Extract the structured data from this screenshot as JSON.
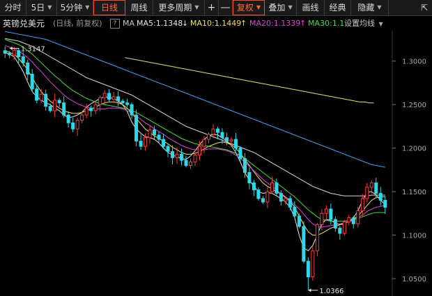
{
  "toolbar": {
    "items": [
      {
        "label": "分时"
      },
      {
        "label": "5日",
        "dropdown": true
      },
      {
        "label": "5分钟",
        "dropdown": true
      },
      {
        "label": "日线",
        "active": true
      },
      {
        "label": "周线"
      },
      {
        "label": "更多周期",
        "dropdown": true
      },
      {
        "label": "+"
      },
      {
        "label": "—"
      },
      {
        "label": "复权",
        "dropdown": true,
        "active": true
      },
      {
        "label": "叠加",
        "dropdown": true
      },
      {
        "label": "画线"
      },
      {
        "label": "经典"
      },
      {
        "label": "隐藏",
        "dropdown": true
      }
    ]
  },
  "legend": {
    "instrument": "英镑兑美元",
    "mode": "(日线, 前复权)",
    "help": "?",
    "ma_label": "MA",
    "ma5": "MA5:1.1348",
    "ma5_arrow": "↓",
    "ma10": "MA10:1.1449",
    "ma10_arrow": "↑",
    "ma20": "MA20:1.1339",
    "ma20_arrow": "↑",
    "ma30": "MA30:1.1",
    "settings": "设置均线",
    "colors": {
      "ma5": "#e8e8e8",
      "ma10": "#f0e25a",
      "ma20": "#e040e0",
      "ma30": "#40e040"
    }
  },
  "chart_data": {
    "type": "candlestick",
    "instrument": "英镑兑美元",
    "ylim": [
      1.03,
      1.335
    ],
    "y_ticks": [
      "1.3000",
      "1.2500",
      "1.2000",
      "1.1500",
      "1.1000",
      "1.0500"
    ],
    "annotations": [
      {
        "label": "1.3147",
        "value": 1.3147,
        "kind": "high"
      },
      {
        "label": "1.0366",
        "value": 1.0366,
        "kind": "low"
      }
    ],
    "close_series": [
      1.309,
      1.307,
      1.312,
      1.305,
      1.298,
      1.285,
      1.268,
      1.255,
      1.262,
      1.248,
      1.243,
      1.255,
      1.252,
      1.238,
      1.229,
      1.222,
      1.232,
      1.238,
      1.246,
      1.243,
      1.25,
      1.258,
      1.263,
      1.256,
      1.259,
      1.254,
      1.252,
      1.25,
      1.238,
      1.208,
      1.202,
      1.212,
      1.221,
      1.215,
      1.21,
      1.202,
      1.196,
      1.189,
      1.193,
      1.186,
      1.18,
      1.184,
      1.192,
      1.202,
      1.21,
      1.216,
      1.222,
      1.218,
      1.212,
      1.208,
      1.21,
      1.2,
      1.188,
      1.172,
      1.16,
      1.152,
      1.142,
      1.138,
      1.15,
      1.16,
      1.148,
      1.139,
      1.142,
      1.132,
      1.122,
      1.11,
      1.07,
      1.052,
      1.082,
      1.112,
      1.125,
      1.13,
      1.118,
      1.108,
      1.102,
      1.115,
      1.12,
      1.113,
      1.128,
      1.142,
      1.155,
      1.16,
      1.148,
      1.14,
      1.132
    ],
    "ma_series": [
      {
        "name": "MA5",
        "color": "#e8e8e8",
        "values": [
          1.31,
          1.308,
          1.305,
          1.297,
          1.288,
          1.276,
          1.265,
          1.259,
          1.255,
          1.252,
          1.25,
          1.246,
          1.243,
          1.238,
          1.235,
          1.236,
          1.238,
          1.241,
          1.247,
          1.251,
          1.254,
          1.257,
          1.259,
          1.258,
          1.257,
          1.254,
          1.25,
          1.242,
          1.23,
          1.222,
          1.217,
          1.213,
          1.212,
          1.21,
          1.206,
          1.2,
          1.195,
          1.192,
          1.19,
          1.188,
          1.187,
          1.191,
          1.197,
          1.204,
          1.21,
          1.214,
          1.216,
          1.215,
          1.212,
          1.208,
          1.203,
          1.195,
          1.184,
          1.172,
          1.163,
          1.156,
          1.15,
          1.148,
          1.149,
          1.148,
          1.145,
          1.142,
          1.138,
          1.132,
          1.12,
          1.1,
          1.085,
          1.082,
          1.088,
          1.1,
          1.113,
          1.118,
          1.117,
          1.114,
          1.112,
          1.113,
          1.116,
          1.12,
          1.128,
          1.14,
          1.149,
          1.15,
          1.146,
          1.14,
          1.135
        ]
      },
      {
        "name": "MA10",
        "color": "#f0e25a",
        "values": [
          1.312,
          1.31,
          1.308,
          1.303,
          1.297,
          1.29,
          1.281,
          1.272,
          1.265,
          1.259,
          1.254,
          1.25,
          1.246,
          1.243,
          1.241,
          1.24,
          1.24,
          1.241,
          1.243,
          1.245,
          1.247,
          1.25,
          1.252,
          1.253,
          1.253,
          1.252,
          1.25,
          1.246,
          1.24,
          1.234,
          1.228,
          1.222,
          1.218,
          1.214,
          1.211,
          1.208,
          1.205,
          1.201,
          1.198,
          1.195,
          1.193,
          1.193,
          1.194,
          1.196,
          1.199,
          1.202,
          1.204,
          1.206,
          1.207,
          1.206,
          1.204,
          1.2,
          1.194,
          1.187,
          1.18,
          1.173,
          1.166,
          1.16,
          1.156,
          1.153,
          1.15,
          1.147,
          1.143,
          1.139,
          1.132,
          1.122,
          1.112,
          1.104,
          1.1,
          1.1,
          1.102,
          1.105,
          1.108,
          1.11,
          1.112,
          1.114,
          1.116,
          1.118,
          1.122,
          1.128,
          1.134,
          1.14,
          1.143,
          1.144,
          1.144
        ]
      },
      {
        "name": "MA20",
        "color": "#e040e0",
        "values": [
          1.318,
          1.316,
          1.314,
          1.312,
          1.308,
          1.304,
          1.299,
          1.293,
          1.288,
          1.282,
          1.276,
          1.271,
          1.266,
          1.261,
          1.257,
          1.254,
          1.251,
          1.249,
          1.247,
          1.246,
          1.245,
          1.245,
          1.245,
          1.246,
          1.246,
          1.246,
          1.245,
          1.243,
          1.24,
          1.237,
          1.233,
          1.229,
          1.226,
          1.222,
          1.219,
          1.216,
          1.212,
          1.209,
          1.206,
          1.203,
          1.201,
          1.199,
          1.198,
          1.198,
          1.198,
          1.199,
          1.199,
          1.199,
          1.198,
          1.197,
          1.195,
          1.192,
          1.188,
          1.184,
          1.179,
          1.174,
          1.169,
          1.164,
          1.16,
          1.156,
          1.152,
          1.148,
          1.144,
          1.14,
          1.135,
          1.13,
          1.124,
          1.118,
          1.113,
          1.11,
          1.109,
          1.11,
          1.111,
          1.112,
          1.113,
          1.114,
          1.115,
          1.117,
          1.12,
          1.123,
          1.127,
          1.13,
          1.132,
          1.133,
          1.134
        ]
      },
      {
        "name": "MA30",
        "color": "#40e040",
        "values": [
          1.325,
          1.323,
          1.321,
          1.319,
          1.316,
          1.312,
          1.308,
          1.303,
          1.298,
          1.293,
          1.288,
          1.283,
          1.279,
          1.274,
          1.27,
          1.266,
          1.263,
          1.26,
          1.257,
          1.255,
          1.253,
          1.251,
          1.25,
          1.249,
          1.248,
          1.247,
          1.246,
          1.245,
          1.243,
          1.241,
          1.238,
          1.235,
          1.232,
          1.229,
          1.226,
          1.223,
          1.22,
          1.217,
          1.214,
          1.211,
          1.209,
          1.207,
          1.205,
          1.204,
          1.203,
          1.202,
          1.201,
          1.2,
          1.199,
          1.198,
          1.196,
          1.194,
          1.191,
          1.188,
          1.184,
          1.18,
          1.176,
          1.172,
          1.168,
          1.164,
          1.16,
          1.156,
          1.152,
          1.148,
          1.144,
          1.139,
          1.134,
          1.129,
          1.125,
          1.121,
          1.118,
          1.117,
          1.116,
          1.116,
          1.116,
          1.116,
          1.117,
          1.118,
          1.119,
          1.121,
          1.123,
          1.125,
          1.126,
          1.126,
          1.126
        ]
      },
      {
        "name": "MA60",
        "color": "#d8d8d8",
        "values": [
          1.326,
          1.325,
          1.324,
          1.323,
          1.321,
          1.319,
          1.317,
          1.314,
          1.311,
          1.308,
          1.305,
          1.302,
          1.299,
          1.296,
          1.293,
          1.29,
          1.287,
          1.284,
          1.281,
          1.279,
          1.277,
          1.275,
          1.273,
          1.271,
          1.269,
          1.267,
          1.265,
          1.263,
          1.261,
          1.258,
          1.255,
          1.252,
          1.249,
          1.246,
          1.243,
          1.24,
          1.237,
          1.234,
          1.231,
          1.228,
          1.225,
          1.223,
          1.221,
          1.219,
          1.217,
          1.215,
          1.213,
          1.211,
          1.209,
          1.207,
          1.205,
          1.203,
          1.201,
          1.199,
          1.197,
          1.195,
          1.192,
          1.189,
          1.186,
          1.183,
          1.18,
          1.177,
          1.174,
          1.171,
          1.168,
          1.165,
          1.162,
          1.159,
          1.156,
          1.154,
          1.152,
          1.15,
          1.148,
          1.147,
          1.146,
          1.145,
          1.145,
          1.145,
          1.145,
          1.145,
          1.145,
          1.146,
          1.146,
          1.146,
          1.146
        ]
      },
      {
        "name": "MA120",
        "color": "#3aa0e8",
        "values": [
          1.334,
          1.333,
          1.332,
          1.331,
          1.33,
          1.329,
          1.328,
          1.327,
          1.326,
          1.325,
          1.323,
          1.321,
          1.319,
          1.317,
          1.315,
          1.313,
          1.311,
          1.309,
          1.307,
          1.305,
          1.303,
          1.301,
          1.299,
          1.297,
          1.295,
          1.293,
          1.291,
          1.289,
          1.287,
          1.285,
          1.283,
          1.281,
          1.279,
          1.277,
          1.275,
          1.273,
          1.271,
          1.269,
          1.267,
          1.265,
          1.263,
          1.261,
          1.259,
          1.257,
          1.255,
          1.253,
          1.251,
          1.249,
          1.247,
          1.245,
          1.243,
          1.241,
          1.239,
          1.237,
          1.235,
          1.233,
          1.231,
          1.229,
          1.227,
          1.225,
          1.223,
          1.221,
          1.219,
          1.217,
          1.215,
          1.213,
          1.211,
          1.209,
          1.207,
          1.205,
          1.203,
          1.201,
          1.199,
          1.197,
          1.195,
          1.193,
          1.191,
          1.189,
          1.187,
          1.185,
          1.183,
          1.181,
          1.18,
          1.179,
          1.178
        ]
      },
      {
        "name": "MA250",
        "color": "#e8e06a",
        "start_index": 30,
        "values": [
          1.304,
          1.303,
          1.302,
          1.301,
          1.3,
          1.299,
          1.298,
          1.297,
          1.296,
          1.295,
          1.294,
          1.293,
          1.292,
          1.291,
          1.29,
          1.289,
          1.288,
          1.287,
          1.286,
          1.285,
          1.284,
          1.283,
          1.282,
          1.281,
          1.28,
          1.279,
          1.278,
          1.277,
          1.276,
          1.275,
          1.274,
          1.273,
          1.272,
          1.271,
          1.27,
          1.269,
          1.268,
          1.267,
          1.266,
          1.265,
          1.264,
          1.263,
          1.262,
          1.261,
          1.26,
          1.259,
          1.258,
          1.257,
          1.256,
          1.255,
          1.254,
          1.253,
          1.253,
          1.252,
          1.252
        ]
      }
    ]
  }
}
